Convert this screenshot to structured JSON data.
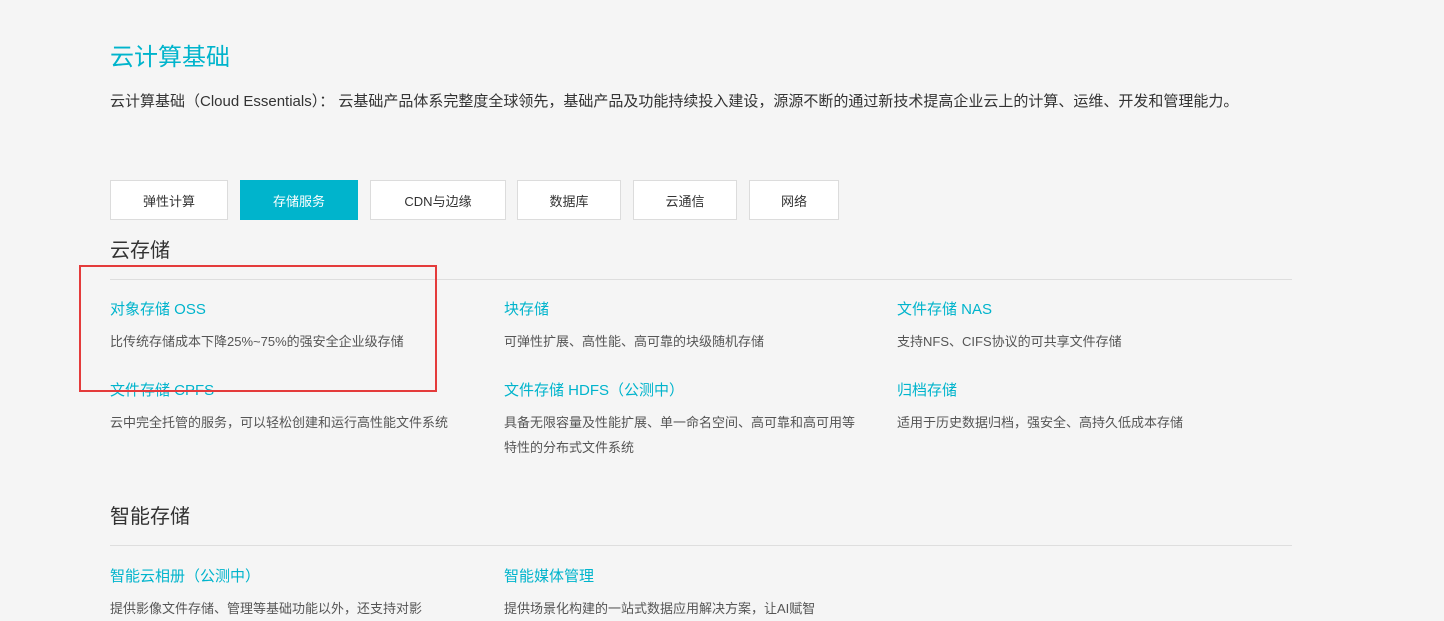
{
  "header": {
    "title": "云计算基础",
    "description": "云计算基础（Cloud Essentials）：  云基础产品体系完整度全球领先，基础产品及功能持续投入建设，源源不断的通过新技术提高企业云上的计算、运维、开发和管理能力。"
  },
  "tabs": [
    {
      "label": "弹性计算"
    },
    {
      "label": "存储服务",
      "active": true
    },
    {
      "label": "CDN与边缘"
    },
    {
      "label": "数据库"
    },
    {
      "label": "云通信"
    },
    {
      "label": "网络"
    }
  ],
  "sections": [
    {
      "title": "云存储",
      "items": [
        {
          "title": "对象存储 OSS",
          "desc": "比传统存储成本下降25%~75%的强安全企业级存储"
        },
        {
          "title": "块存储",
          "desc": "可弹性扩展、高性能、高可靠的块级随机存储"
        },
        {
          "title": "文件存储 NAS",
          "desc": "支持NFS、CIFS协议的可共享文件存储"
        },
        {
          "title": "文件存储 CPFS",
          "desc": "云中完全托管的服务，可以轻松创建和运行高性能文件系统"
        },
        {
          "title": "文件存储 HDFS（公测中）",
          "desc": "具备无限容量及性能扩展、单一命名空间、高可靠和高可用等特性的分布式文件系统"
        },
        {
          "title": "归档存储",
          "desc": "适用于历史数据归档，强安全、高持久低成本存储"
        }
      ]
    },
    {
      "title": "智能存储",
      "items": [
        {
          "title": "智能云相册（公测中）",
          "desc": "提供影像文件存储、管理等基础功能以外，还支持对影"
        },
        {
          "title": "智能媒体管理",
          "desc": "提供场景化构建的一站式数据应用解决方案，让AI赋智"
        }
      ]
    }
  ],
  "colors": {
    "accent": "#00b4cc",
    "highlight": "#e43b3b",
    "background": "#f5f5f5"
  }
}
